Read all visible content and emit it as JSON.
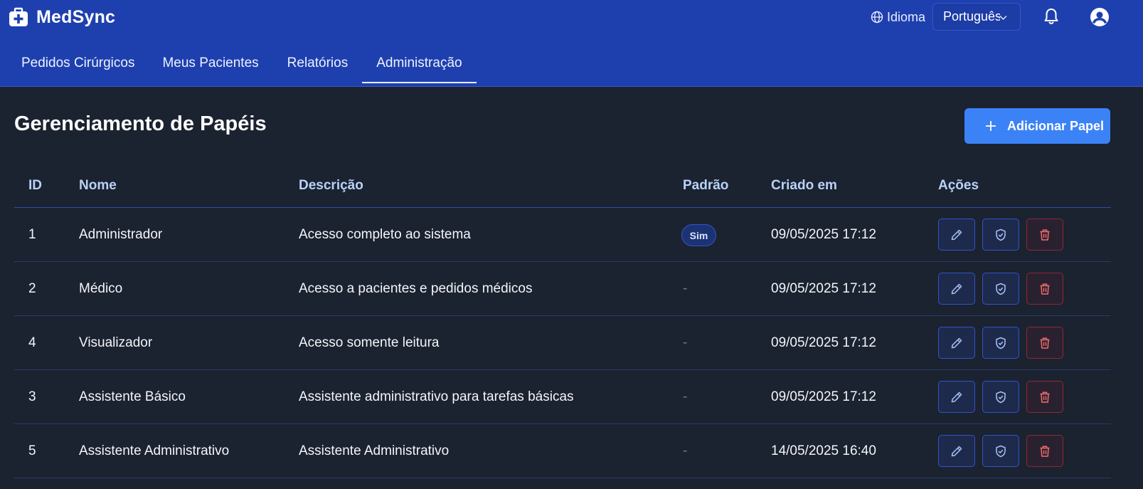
{
  "app": {
    "name": "MedSync"
  },
  "header": {
    "language_label": "Idioma",
    "language_value": "Português",
    "colors": {
      "topbar": "#1e40af",
      "accent": "#3b82f6",
      "danger": "#f87171"
    }
  },
  "nav": {
    "tabs": [
      {
        "label": "Pedidos Cirúrgicos",
        "active": false
      },
      {
        "label": "Meus Pacientes",
        "active": false
      },
      {
        "label": "Relatórios",
        "active": false
      },
      {
        "label": "Administração",
        "active": true
      }
    ]
  },
  "page": {
    "title": "Gerenciamento de Papéis",
    "add_button_label": "Adicionar Papel"
  },
  "table": {
    "headers": {
      "id": "ID",
      "name": "Nome",
      "description": "Descrição",
      "default": "Padrão",
      "created": "Criado em",
      "actions": "Ações"
    },
    "rows": [
      {
        "id": "1",
        "name": "Administrador",
        "description": "Acesso completo ao sistema",
        "default": "Sim",
        "is_default": true,
        "created": "09/05/2025 17:12"
      },
      {
        "id": "2",
        "name": "Médico",
        "description": "Acesso a pacientes e pedidos médicos",
        "default": "-",
        "is_default": false,
        "created": "09/05/2025 17:12"
      },
      {
        "id": "4",
        "name": "Visualizador",
        "description": "Acesso somente leitura",
        "default": "-",
        "is_default": false,
        "created": "09/05/2025 17:12"
      },
      {
        "id": "3",
        "name": "Assistente Básico",
        "description": "Assistente administrativo para tarefas básicas",
        "default": "-",
        "is_default": false,
        "created": "09/05/2025 17:12"
      },
      {
        "id": "5",
        "name": "Assistente Administrativo",
        "description": "Assistente Administrativo",
        "default": "-",
        "is_default": false,
        "created": "14/05/2025 16:40"
      }
    ]
  },
  "icons": {
    "logo": "medical-kit-icon",
    "language": "globe-icon",
    "select": "chevron-down-icon",
    "notifications": "bell-icon",
    "user": "user-avatar-icon",
    "add": "plus-icon",
    "edit": "pencil-icon",
    "permissions": "shield-check-icon",
    "delete": "trash-icon"
  }
}
